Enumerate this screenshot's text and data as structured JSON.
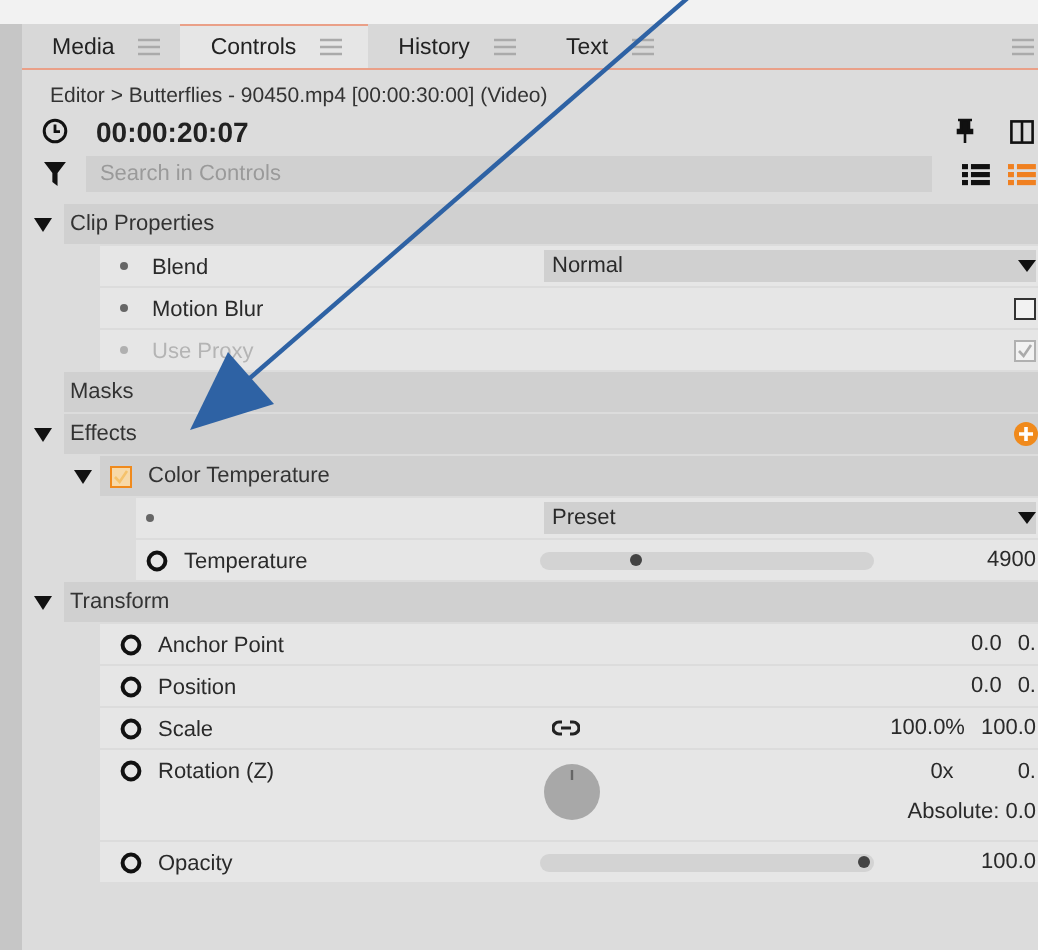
{
  "tabs": [
    {
      "label": "Media",
      "selected": false
    },
    {
      "label": "Controls",
      "selected": true
    },
    {
      "label": "History",
      "selected": false
    },
    {
      "label": "Text",
      "selected": false
    }
  ],
  "breadcrumb": "Editor > Butterflies - 90450.mp4 [00:00:30:00] (Video)",
  "timecode": "00:00:20:07",
  "search": {
    "placeholder": "Search in Controls"
  },
  "view_toggles": [
    {
      "selected": false
    },
    {
      "selected": true
    }
  ],
  "sections": [
    {
      "title": "Clip Properties",
      "expanded": true,
      "addable": false,
      "rows": [
        {
          "kind": "dropdown",
          "label": "Blend",
          "keyframable": false,
          "disabled": false,
          "value": "Normal"
        },
        {
          "kind": "checkbox",
          "label": "Motion Blur",
          "keyframable": false,
          "disabled": false,
          "checked": false
        },
        {
          "kind": "checkbox",
          "label": "Use Proxy",
          "keyframable": false,
          "disabled": true,
          "checked": true
        }
      ]
    },
    {
      "title": "Masks",
      "addable": false
    },
    {
      "title": "Effects",
      "expanded": true,
      "addable": true,
      "effects": [
        {
          "title": "Color Temperature",
          "expanded": true,
          "enabled": true,
          "rows": [
            {
              "kind": "dropdown",
              "keyframable": false,
              "disabled": false,
              "value": "Preset"
            },
            {
              "kind": "slider",
              "label": "Temperature",
              "keyframable": true,
              "disabled": false,
              "level": 0.29,
              "value": "4900"
            }
          ]
        }
      ]
    },
    {
      "title": "Transform",
      "expanded": true,
      "addable": false,
      "rows": [
        {
          "kind": "pair",
          "label": "Anchor Point",
          "keyframable": true,
          "disabled": false,
          "values": [
            "0.0",
            "0."
          ]
        },
        {
          "kind": "pair",
          "label": "Position",
          "keyframable": true,
          "disabled": false,
          "values": [
            "0.0",
            "0."
          ]
        },
        {
          "kind": "scale",
          "label": "Scale",
          "keyframable": true,
          "disabled": false,
          "values": [
            "100.0%",
            "100.0"
          ]
        },
        {
          "kind": "rotation",
          "label": "Rotation (Z)",
          "keyframable": true,
          "disabled": false,
          "values": [
            "0x",
            "0."
          ],
          "absolute": "Absolute: 0.0"
        },
        {
          "kind": "slider",
          "label": "Opacity",
          "keyframable": true,
          "disabled": false,
          "level": 0.97,
          "value": "100.0"
        }
      ]
    }
  ]
}
